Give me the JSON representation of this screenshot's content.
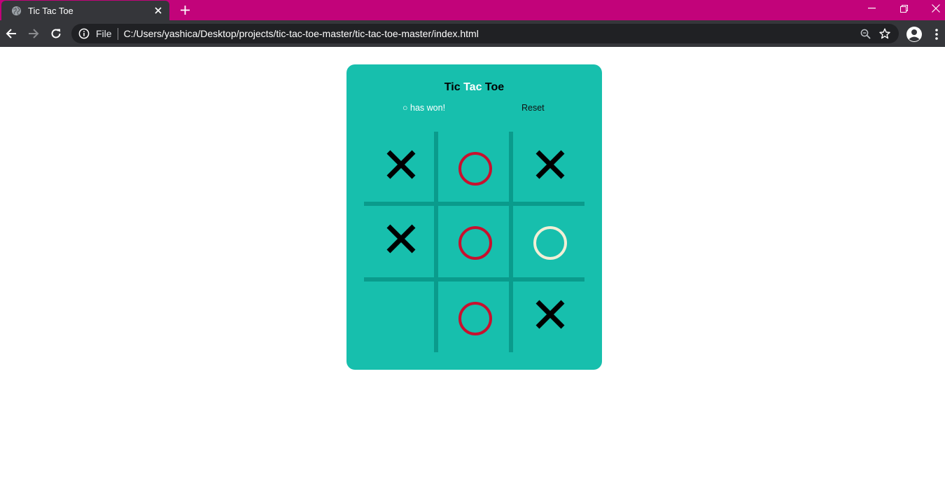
{
  "browser": {
    "tab_title": "Tic Tac Toe",
    "omnibox_scheme_label": "File",
    "url": "C:/Users/yashica/Desktop/projects/tic-tac-toe-master/tic-tac-toe-master/index.html",
    "icons": [
      "globe-icon",
      "close-icon",
      "plus-icon",
      "minimize-icon",
      "restore-icon",
      "window-close-icon",
      "back-arrow-icon",
      "forward-arrow-icon",
      "reload-icon",
      "info-icon",
      "zoom-icon",
      "star-icon",
      "account-icon",
      "kebab-menu-icon"
    ],
    "colors": {
      "tab_strip": "#c2037a",
      "toolbar": "#35363a",
      "omnibox": "#202124"
    }
  },
  "game": {
    "title_words": [
      "Tic",
      "Tac",
      "Toe"
    ],
    "status": "○ has won!",
    "reset_label": "Reset",
    "board": [
      "X",
      "O",
      "X",
      "X",
      "O",
      "O",
      "",
      "O",
      "X"
    ],
    "highlighted_cell": 5,
    "colors": {
      "card": "#17bfad",
      "grid": "#0a9b8c",
      "x_mark": "#000000",
      "o_mark": "#c8102e",
      "o_highlight": "#f2efd6"
    }
  }
}
